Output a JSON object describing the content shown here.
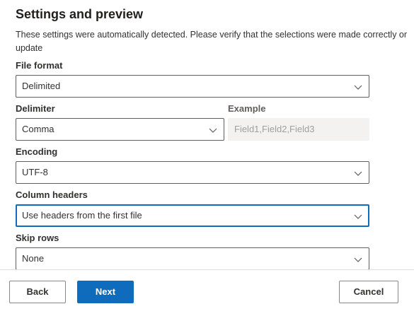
{
  "header": {
    "title": "Settings and preview",
    "description": "These settings were automatically detected. Please verify that the selections were made correctly or update"
  },
  "fields": {
    "file_format": {
      "label": "File format",
      "value": "Delimited"
    },
    "delimiter": {
      "label": "Delimiter",
      "value": "Comma"
    },
    "example": {
      "label": "Example",
      "value": "Field1,Field2,Field3"
    },
    "encoding": {
      "label": "Encoding",
      "value": "UTF-8"
    },
    "column_headers": {
      "label": "Column headers",
      "value": "Use headers from the first file"
    },
    "skip_rows": {
      "label": "Skip rows",
      "value": "None"
    }
  },
  "footer": {
    "back_label": "Back",
    "next_label": "Next",
    "cancel_label": "Cancel"
  },
  "colors": {
    "primary": "#0f6cbd",
    "border": "#605e5c",
    "text": "#323130",
    "disabled_bg": "#f3f2f1"
  },
  "icons": {
    "dropdown": "chevron-down-icon"
  }
}
